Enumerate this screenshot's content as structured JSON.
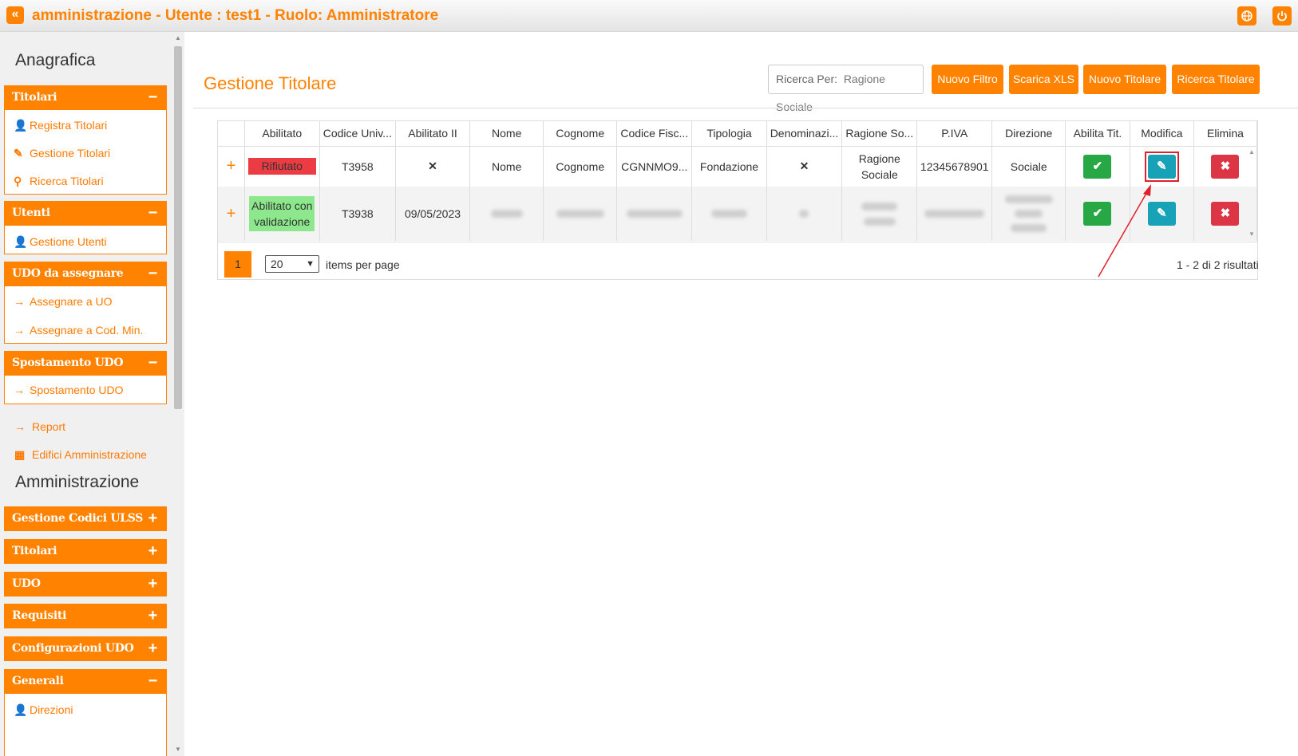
{
  "topbar": {
    "back_icon": "«",
    "title": "amministrazione - Utente : test1 - Ruolo: Amministratore",
    "language_icon": "globe-icon",
    "power_icon": "power-icon"
  },
  "sidebar": {
    "anagrafica_title": "Anagrafica",
    "titolari": {
      "label": "Titolari",
      "sign": "−",
      "items": [
        "Registra Titolari",
        "Gestione Titolari",
        "Ricerca Titolari"
      ]
    },
    "utenti": {
      "label": "Utenti",
      "sign": "−",
      "items": [
        "Gestione Utenti"
      ]
    },
    "udo_da_assegnare": {
      "label": "UDO da assegnare",
      "sign": "−",
      "items": [
        "Assegnare a UO",
        "Assegnare a Cod. Min."
      ]
    },
    "spostamento": {
      "label": "Spostamento UDO",
      "sign": "−",
      "items": [
        "Spostamento UDO"
      ]
    },
    "report": "Report",
    "edifici": "Edifici Amministrazione",
    "amministrazione_title": "Amministrazione",
    "admin_panels": [
      {
        "label": "Gestione Codici ULSS",
        "sign": "+"
      },
      {
        "label": "Titolari",
        "sign": "+"
      },
      {
        "label": "UDO",
        "sign": "+"
      },
      {
        "label": "Requisiti",
        "sign": "+"
      },
      {
        "label": "Configurazioni UDO",
        "sign": "+"
      }
    ],
    "generali": {
      "label": "Generali",
      "sign": "−",
      "items": [
        "Direzioni"
      ]
    }
  },
  "main": {
    "title": "Gestione Titolare",
    "search": {
      "label": "Ricerca Per:",
      "value": "Ragione Sociale"
    },
    "buttons": [
      "Nuovo Filtro",
      "Scarica XLS",
      "Nuovo Titolare",
      "Ricerca Titolare"
    ]
  },
  "table": {
    "headers": [
      "",
      "Abilitato",
      "Codice Univ...",
      "Abilitato II",
      "Nome",
      "Cognome",
      "Codice Fisc...",
      "Tipologia",
      "Denominazi...",
      "Ragione So...",
      "P.IVA",
      "Direzione",
      "Abilita Tit.",
      "Modifica",
      "Elimina"
    ],
    "row1": {
      "expand": "+",
      "abilitato": "Rifiutato",
      "codice": "T3958",
      "abilitato2": "✕",
      "nome": "Nome",
      "cognome": "Cognome",
      "codice_fiscale": "CGNNMO9...",
      "tipologia": "Fondazione",
      "denominazione": "✕",
      "ragione_line1": "Ragione",
      "ragione_line2": "Sociale",
      "piva": "12345678901",
      "direzione": "Sociale"
    },
    "row2": {
      "expand": "+",
      "abilitato_line1": "Abilitato con",
      "abilitato_line2": "validazione",
      "codice": "T3938",
      "abilitato2": "09/05/2023"
    },
    "check_icon": "✔",
    "edit_icon": "✎",
    "delete_icon": "✖"
  },
  "pager": {
    "page": "1",
    "page_size": "20",
    "items_label": "items per page",
    "results": "1 - 2 di 2 risultati"
  }
}
